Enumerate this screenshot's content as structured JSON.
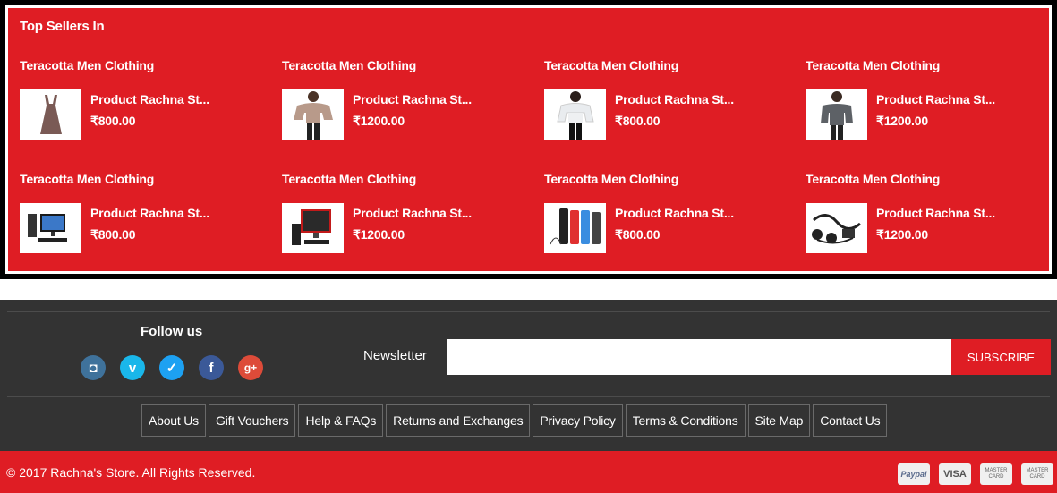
{
  "top_sellers": {
    "title": "Top Sellers In",
    "items": [
      {
        "category": "Teracotta Men Clothing",
        "name": "Product Rachna St...",
        "price": "₹800.00",
        "image": "top-dress-image"
      },
      {
        "category": "Teracotta Men Clothing",
        "name": "Product Rachna St...",
        "price": "₹1200.00",
        "image": "blouse-model-image"
      },
      {
        "category": "Teracotta Men Clothing",
        "name": "Product Rachna St...",
        "price": "₹800.00",
        "image": "white-top-model-image"
      },
      {
        "category": "Teracotta Men Clothing",
        "name": "Product Rachna St...",
        "price": "₹1200.00",
        "image": "grey-sweater-model-image"
      },
      {
        "category": "Teracotta Men Clothing",
        "name": "Product Rachna St...",
        "price": "₹800.00",
        "image": "desktop-computer-image"
      },
      {
        "category": "Teracotta Men Clothing",
        "name": "Product Rachna St...",
        "price": "₹1200.00",
        "image": "red-computer-image"
      },
      {
        "category": "Teracotta Men Clothing",
        "name": "Product Rachna St...",
        "price": "₹800.00",
        "image": "mobile-phones-image"
      },
      {
        "category": "Teracotta Men Clothing",
        "name": "Product Rachna St...",
        "price": "₹1200.00",
        "image": "earphones-image"
      }
    ]
  },
  "footer": {
    "follow_title": "Follow us",
    "social": [
      {
        "name": "instagram-icon",
        "glyph": "◘",
        "color": "#3f729b"
      },
      {
        "name": "vimeo-icon",
        "glyph": "v",
        "color": "#1ab7ea"
      },
      {
        "name": "twitter-icon",
        "glyph": "✓",
        "color": "#1da1f2"
      },
      {
        "name": "facebook-icon",
        "glyph": "f",
        "color": "#3b5998"
      },
      {
        "name": "google-plus-icon",
        "glyph": "g+",
        "color": "#dd4b39"
      }
    ],
    "newsletter_label": "Newsletter",
    "newsletter_value": "",
    "subscribe_label": "SUBSCRIBE",
    "links": [
      "About Us",
      "Gift Vouchers",
      "Help & FAQs",
      "Returns and Exchanges",
      "Privacy Policy",
      "Terms & Conditions",
      "Site Map",
      "Contact Us"
    ]
  },
  "bottom": {
    "copyright": "© 2017 Rachna's Store. All Rights Reserved.",
    "payments": [
      "Paypal",
      "VISA",
      "MASTER CARD",
      "MASTER CARD"
    ]
  },
  "colors": {
    "brand_red": "#df1d24",
    "footer_dark": "#333333"
  }
}
